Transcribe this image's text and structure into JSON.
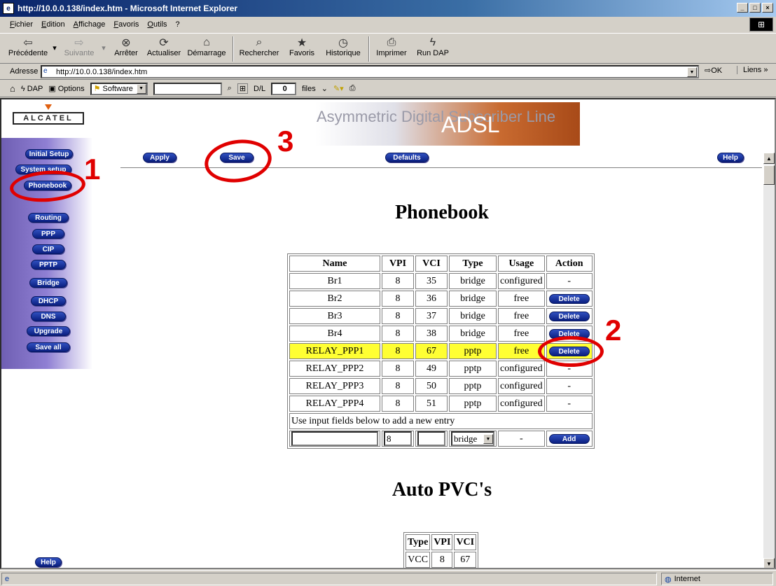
{
  "window": {
    "title": "http://10.0.0.138/index.htm - Microsoft Internet Explorer"
  },
  "menu": [
    "Fichier",
    "Edition",
    "Affichage",
    "Favoris",
    "Outils",
    "?"
  ],
  "toolbar": {
    "back": "Précédente",
    "forward": "Suivante",
    "stop": "Arrêter",
    "refresh": "Actualiser",
    "home": "Démarrage",
    "search": "Rechercher",
    "favorites": "Favoris",
    "history": "Historique",
    "print": "Imprimer",
    "rundap": "Run DAP"
  },
  "address": {
    "label": "Adresse",
    "url": "http://10.0.0.138/index.htm",
    "go": "OK",
    "links": "Liens"
  },
  "dapbar": {
    "dap": "DAP",
    "options": "Options",
    "category": "Software",
    "dl_label": "D/L",
    "dl_count": "0",
    "files": "files"
  },
  "brand": {
    "logo": "ALCATEL",
    "banner_text": "Asymmetric Digital Subscriber Line",
    "banner_big": "ADSL"
  },
  "nav": {
    "initial_setup": "Initial Setup",
    "system_setup": "System setup",
    "phonebook": "Phonebook",
    "routing": "Routing",
    "ppp": "PPP",
    "cip": "CIP",
    "pptp": "PPTP",
    "bridge": "Bridge",
    "dhcp": "DHCP",
    "dns": "DNS",
    "upgrade": "Upgrade",
    "save_all": "Save all",
    "help": "Help"
  },
  "actions": {
    "apply": "Apply",
    "save": "Save",
    "defaults": "Defaults",
    "help": "Help"
  },
  "phonebook": {
    "title": "Phonebook",
    "headers": [
      "Name",
      "VPI",
      "VCI",
      "Type",
      "Usage",
      "Action"
    ],
    "rows": [
      {
        "name": "Br1",
        "vpi": "8",
        "vci": "35",
        "type": "bridge",
        "usage": "configured",
        "action": "-"
      },
      {
        "name": "Br2",
        "vpi": "8",
        "vci": "36",
        "type": "bridge",
        "usage": "free",
        "action": "Delete"
      },
      {
        "name": "Br3",
        "vpi": "8",
        "vci": "37",
        "type": "bridge",
        "usage": "free",
        "action": "Delete"
      },
      {
        "name": "Br4",
        "vpi": "8",
        "vci": "38",
        "type": "bridge",
        "usage": "free",
        "action": "Delete"
      },
      {
        "name": "RELAY_PPP1",
        "vpi": "8",
        "vci": "67",
        "type": "pptp",
        "usage": "free",
        "action": "Delete"
      },
      {
        "name": "RELAY_PPP2",
        "vpi": "8",
        "vci": "49",
        "type": "pptp",
        "usage": "configured",
        "action": "-"
      },
      {
        "name": "RELAY_PPP3",
        "vpi": "8",
        "vci": "50",
        "type": "pptp",
        "usage": "configured",
        "action": "-"
      },
      {
        "name": "RELAY_PPP4",
        "vpi": "8",
        "vci": "51",
        "type": "pptp",
        "usage": "configured",
        "action": "-"
      }
    ],
    "add_hint": "Use input fields below to add a new entry",
    "add_vpi": "8",
    "add_type": "bridge",
    "add_usage": "-",
    "add_button": "Add"
  },
  "auto_pvc": {
    "title": "Auto PVC's",
    "headers": [
      "Type",
      "VPI",
      "VCI"
    ],
    "rows": [
      {
        "type": "VCC",
        "vpi": "8",
        "vci": "67"
      }
    ]
  },
  "annotations": {
    "one": "1",
    "two": "2",
    "three": "3"
  },
  "status": {
    "zone": "Internet"
  }
}
